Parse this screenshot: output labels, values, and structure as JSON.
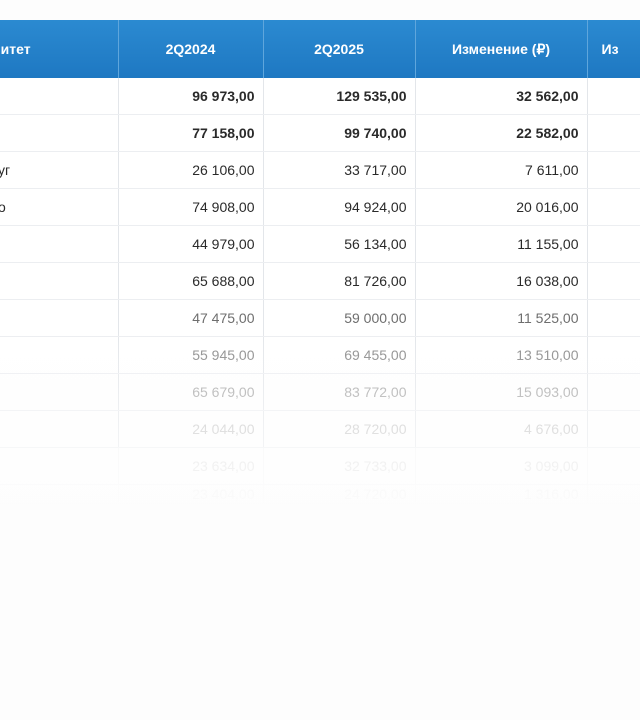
{
  "table": {
    "headers": [
      "алитет",
      "2Q2024",
      "2Q2025",
      "Изменение (₽)",
      "Из"
    ],
    "rows": [
      {
        "name": "",
        "v1": "96 973,00",
        "v2": "129 535,00",
        "v3": "32 562,00",
        "v4": "",
        "bold": true
      },
      {
        "name": "",
        "v1": "77 158,00",
        "v2": "99 740,00",
        "v3": "22 582,00",
        "v4": "",
        "bold": true
      },
      {
        "name": "уг",
        "v1": "26 106,00",
        "v2": "33 717,00",
        "v3": "7 611,00",
        "v4": "",
        "bold": false
      },
      {
        "name": "о",
        "v1": "74 908,00",
        "v2": "94 924,00",
        "v3": "20 016,00",
        "v4": "",
        "bold": false
      },
      {
        "name": "",
        "v1": "44 979,00",
        "v2": "56 134,00",
        "v3": "11 155,00",
        "v4": "",
        "bold": false
      },
      {
        "name": "",
        "v1": "65 688,00",
        "v2": "81 726,00",
        "v3": "16 038,00",
        "v4": "",
        "bold": false
      },
      {
        "name": "",
        "v1": "47 475,00",
        "v2": "59 000,00",
        "v3": "11 525,00",
        "v4": "",
        "bold": false
      },
      {
        "name": "",
        "v1": "55 945,00",
        "v2": "69 455,00",
        "v3": "13 510,00",
        "v4": "",
        "bold": false
      },
      {
        "name": "",
        "v1": "65 679,00",
        "v2": "83 772,00",
        "v3": "15 093,00",
        "v4": "",
        "bold": false
      },
      {
        "name": "",
        "v1": "24 044,00",
        "v2": "28 720,00",
        "v3": "4 676,00",
        "v4": "",
        "bold": false
      },
      {
        "name": "",
        "v1": "23 634,00",
        "v2": "32 733,00",
        "v3": "3 099,00",
        "v4": "",
        "bold": false
      },
      {
        "name": "",
        "v1": "23 404,00",
        "v2": "24 720,00",
        "v3": "1 316,00",
        "v4": "",
        "bold": false
      }
    ]
  }
}
